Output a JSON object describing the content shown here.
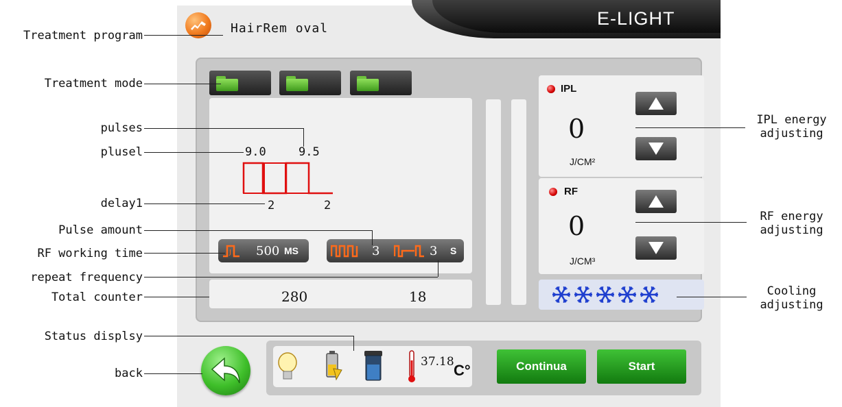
{
  "annotations": {
    "treatment_program": "Treatment program",
    "treatment_mode": "Treatment mode",
    "pulses": "pulses",
    "plusel": "plusel",
    "delay1": "delay1",
    "pulse_amount": "Pulse amount",
    "rf_working_time": "RF working time",
    "repeat_frequency": "repeat frequency",
    "total_counter": "Total counter",
    "status_display": "Status displsy",
    "back": "back",
    "ipl_energy_adjusting": "IPL energy\nadjusting",
    "rf_energy_adjusting": "RF energy\nadjusting",
    "cooling_adjusting": "Cooling\nadjusting"
  },
  "header": {
    "brand": "E-LIGHT",
    "program_name": "HairRem oval"
  },
  "mode_tabs": [
    {
      "icon": "folder-icon"
    },
    {
      "icon": "folder-icon"
    },
    {
      "icon": "folder-icon"
    }
  ],
  "waveform": {
    "pulse1": "9.0",
    "pulse2": "9.5",
    "delay1": "2",
    "delay2": "2",
    "color": "#e01010"
  },
  "controls": {
    "rf_time_value": "500",
    "rf_time_unit": "MS",
    "pulse_amount": "3",
    "repeat_frequency": "3",
    "repeat_unit": "S"
  },
  "counters": {
    "total": "280",
    "second": "18"
  },
  "ipl": {
    "label": "IPL",
    "value": "0",
    "unit": "J/CM²"
  },
  "rf": {
    "label": "RF",
    "value": "0",
    "unit": "J/CM³"
  },
  "cooling": {
    "level": 5,
    "icon": "snowflake-icon",
    "color": "#1f3fcf"
  },
  "status": {
    "temperature": "37.18",
    "temp_unit": "C°",
    "icons": [
      "bulb-icon",
      "battery-icon",
      "water-tank-icon",
      "thermometer-icon"
    ]
  },
  "buttons": {
    "continua": "Continua",
    "start": "Start"
  },
  "colors": {
    "accent_green": "#2fa428",
    "led_red": "#d40000",
    "panel_gray": "#c8c8c8"
  }
}
